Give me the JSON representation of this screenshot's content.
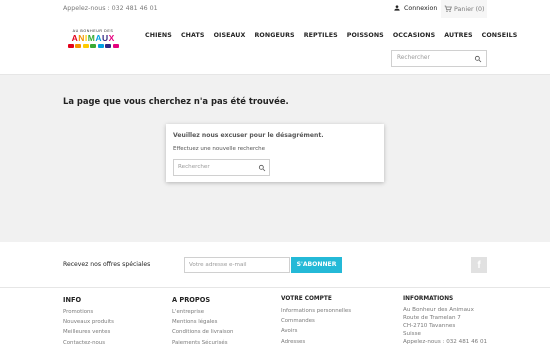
{
  "topbar": {
    "phone": "Appelez-nous : 032 481 46 01",
    "login": "Connexion",
    "cart": "Panier (0)"
  },
  "logo": {
    "line1": "AU BONHEUR DES",
    "letters": [
      {
        "ch": "A",
        "color": "#e2001a"
      },
      {
        "ch": "N",
        "color": "#f39200"
      },
      {
        "ch": "I",
        "color": "#ffcc00"
      },
      {
        "ch": "M",
        "color": "#3aaa35"
      },
      {
        "ch": "A",
        "color": "#009fe3"
      },
      {
        "ch": "U",
        "color": "#312783"
      },
      {
        "ch": "X",
        "color": "#e6007e"
      }
    ],
    "paw_colors": [
      "#e2001a",
      "#f39200",
      "#ffcc00",
      "#3aaa35",
      "#009fe3",
      "#312783",
      "#e6007e"
    ]
  },
  "menu": [
    "CHIENS",
    "CHATS",
    "OISEAUX",
    "RONGEURS",
    "REPTILES",
    "POISSONS",
    "OCCASIONS",
    "AUTRES",
    "CONSEILS"
  ],
  "header_search": {
    "placeholder": "Rechercher"
  },
  "main": {
    "title": "La page que vous cherchez n'a pas été trouvée.",
    "card_title": "Veuillez nous excuser pour le désagrément.",
    "card_sub": "Effectuez une nouvelle recherche",
    "search_placeholder": "Rechercher"
  },
  "newsletter": {
    "label": "Recevez nos offres spéciales",
    "placeholder": "Votre adresse e-mail",
    "button": "S'ABONNER",
    "social": "f"
  },
  "footer": {
    "info": {
      "title": "INFO",
      "items": [
        "Promotions",
        "Nouveaux produits",
        "Meilleures ventes",
        "Contactez-nous"
      ]
    },
    "apropos": {
      "title": "A PROPOS",
      "items": [
        "L'entreprise",
        "Mentions légales",
        "Conditions de livraison",
        "Paiements Sécurisés"
      ]
    },
    "compte": {
      "title": "VOTRE COMPTE",
      "items": [
        "Informations personnelles",
        "Commandes",
        "Avoirs",
        "Adresses"
      ]
    },
    "informations": {
      "title": "INFORMATIONS",
      "lines": [
        "Au Bonheur des Animaux",
        "Route de Tramelan 7",
        "CH-2710 Tavannes",
        "Suisse",
        "Appelez-nous : 032 481 46 01"
      ]
    }
  },
  "colors": {
    "accent": "#24b9d7",
    "background": "#f1f1f1"
  }
}
